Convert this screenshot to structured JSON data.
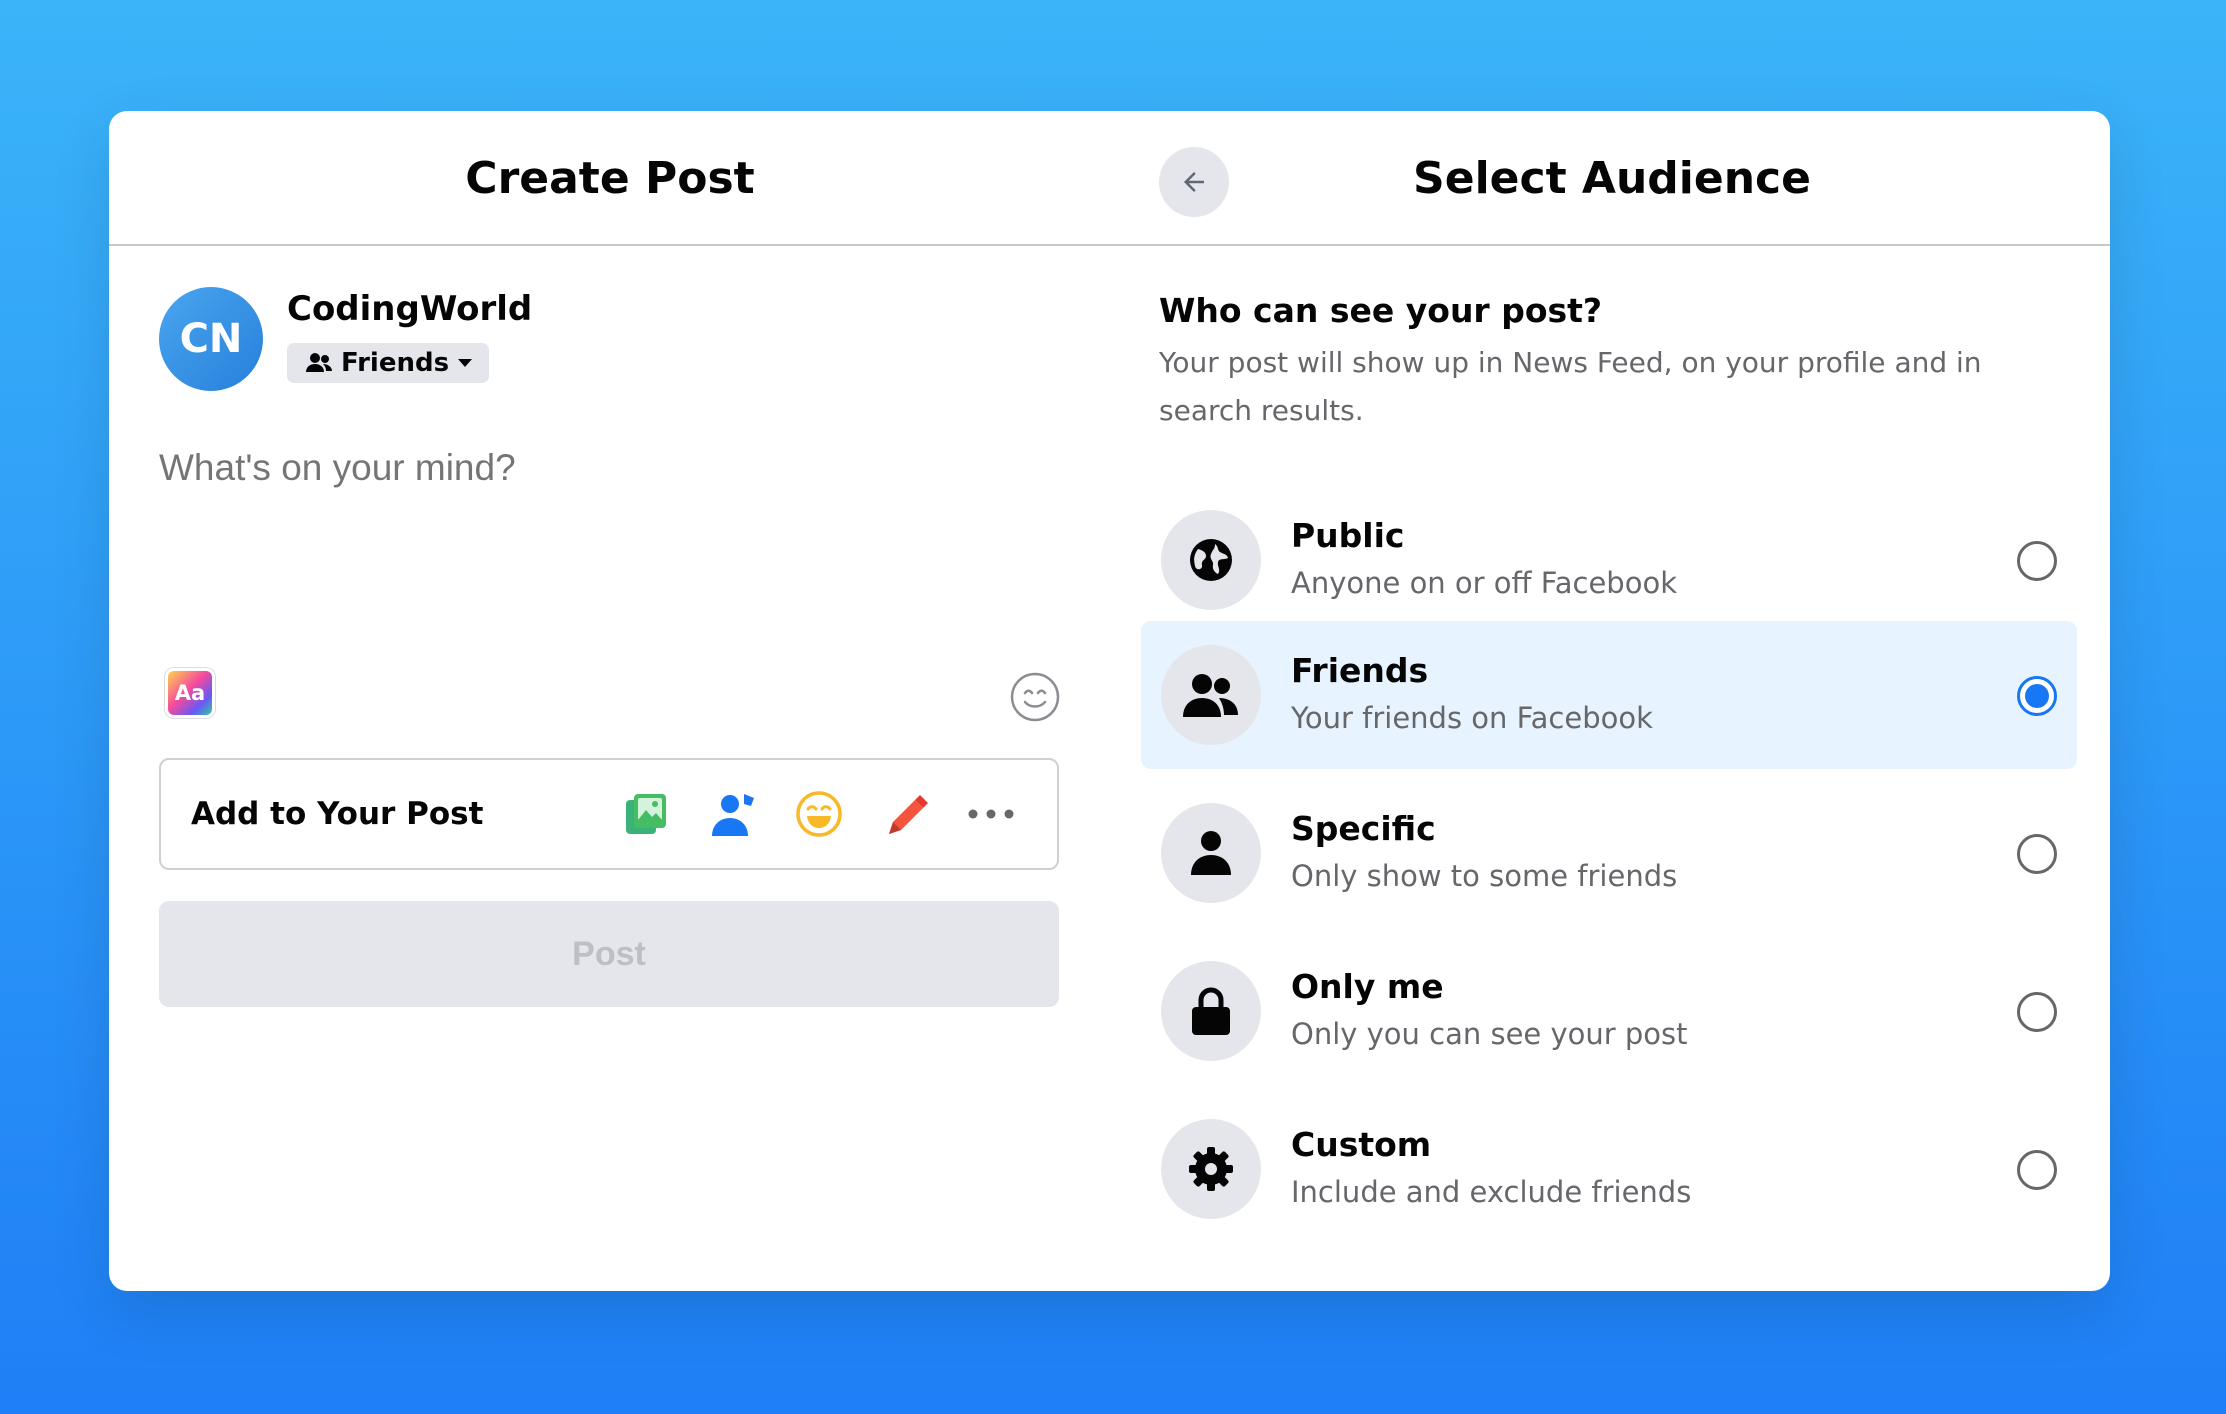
{
  "create_post": {
    "title": "Create Post",
    "avatar_initials": "CN",
    "username": "CodingWorld",
    "privacy_label": "Friends",
    "composer_placeholder": "What's on your mind?",
    "add_to_post_label": "Add to Your Post",
    "add_icons": [
      "photo-video-icon",
      "tag-people-icon",
      "feeling-icon",
      "checkin-icon",
      "more-icon"
    ],
    "post_button_label": "Post"
  },
  "audience": {
    "title": "Select Audience",
    "question": "Who can see your post?",
    "description": "Your post will show up in News Feed, on your profile and in search results.",
    "options": [
      {
        "title": "Public",
        "subtitle": "Anyone on or off Facebook",
        "icon": "globe-icon",
        "selected": false
      },
      {
        "title": "Friends",
        "subtitle": "Your friends on Facebook",
        "icon": "friends-icon",
        "selected": true
      },
      {
        "title": "Specific",
        "subtitle": "Only show to some friends",
        "icon": "person-icon",
        "selected": false
      },
      {
        "title": "Only me",
        "subtitle": "Only you can see your post",
        "icon": "lock-icon",
        "selected": false
      },
      {
        "title": "Custom",
        "subtitle": "Include and exclude friends",
        "icon": "gear-icon",
        "selected": false
      }
    ]
  },
  "colors": {
    "accent": "#1877f2",
    "selected_bg": "#e7f3ff",
    "background_top": "#3bb4f9",
    "background_bottom": "#1e7ff6"
  }
}
